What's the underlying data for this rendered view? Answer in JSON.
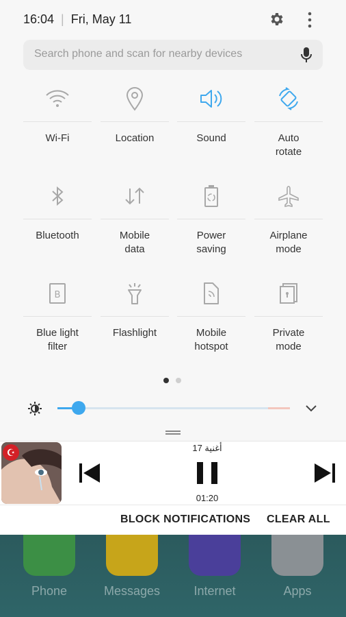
{
  "status_bar": {
    "time": "16:04",
    "date": "Fri, May 11",
    "settings_icon": "gear-icon",
    "menu_icon": "more-vert-icon"
  },
  "search": {
    "placeholder": "Search phone and scan for nearby devices",
    "icon": "mic-icon"
  },
  "tiles": [
    {
      "label": "Wi-Fi",
      "icon": "wifi-icon",
      "active": false
    },
    {
      "label": "Location",
      "icon": "location-pin-icon",
      "active": false
    },
    {
      "label": "Sound",
      "icon": "speaker-icon",
      "active": true
    },
    {
      "label": "Auto\nrotate",
      "icon": "rotate-icon",
      "active": true
    },
    {
      "label": "Bluetooth",
      "icon": "bluetooth-icon",
      "active": false
    },
    {
      "label": "Mobile\ndata",
      "icon": "mobile-data-icon",
      "active": false
    },
    {
      "label": "Power\nsaving",
      "icon": "battery-recycle-icon",
      "active": false
    },
    {
      "label": "Airplane\nmode",
      "icon": "airplane-icon",
      "active": false
    },
    {
      "label": "Blue light\nfilter",
      "icon": "blue-light-icon",
      "active": false
    },
    {
      "label": "Flashlight",
      "icon": "flashlight-icon",
      "active": false
    },
    {
      "label": "Mobile\nhotspot",
      "icon": "hotspot-icon",
      "active": false
    },
    {
      "label": "Private\nmode",
      "icon": "private-mode-icon",
      "active": false
    }
  ],
  "pager": {
    "current_page": 1,
    "total_pages": 2
  },
  "brightness": {
    "level": 0.09
  },
  "media": {
    "track_title": "أغنية 17",
    "elapsed": "01:20",
    "flag_glyph": "☪"
  },
  "actions": {
    "block": "BLOCK NOTIFICATIONS",
    "clear": "CLEAR ALL"
  },
  "home_apps": [
    {
      "label": "Phone",
      "color": "#3c8f45"
    },
    {
      "label": "Messages",
      "color": "#c7a51a"
    },
    {
      "label": "Internet",
      "color": "#4a3f9a"
    },
    {
      "label": "Apps",
      "color": "#8a9094"
    }
  ],
  "colors": {
    "accent": "#3ea8ee",
    "inactive_icon": "#a8a8a8"
  }
}
